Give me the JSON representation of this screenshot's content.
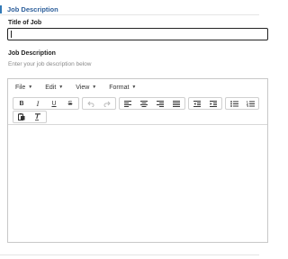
{
  "section": {
    "title": "Job Description"
  },
  "form": {
    "title_label": "Title of Job",
    "title_value": "",
    "desc_label": "Job Description",
    "desc_help": "Enter your job description below"
  },
  "editor": {
    "menus": [
      "File",
      "Edit",
      "View",
      "Format"
    ],
    "buttons": {
      "bold": "B",
      "italic": "I",
      "underline": "U",
      "strike": "S"
    }
  },
  "colors": {
    "accent": "#337ab7"
  }
}
